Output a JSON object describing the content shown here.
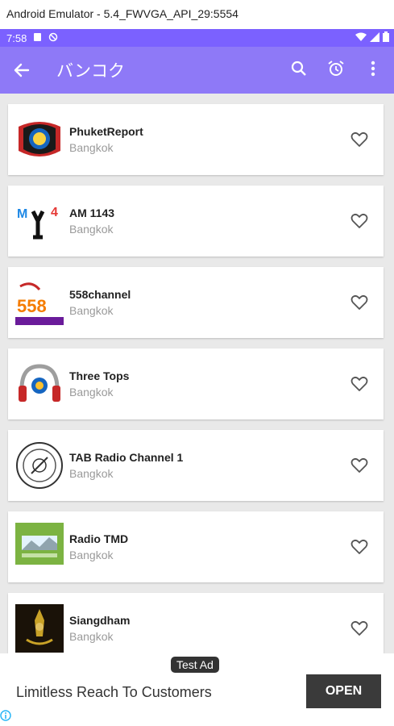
{
  "window": {
    "title": "Android Emulator - 5.4_FWVGA_API_29:5554"
  },
  "status_bar": {
    "time": "7:58"
  },
  "app_bar": {
    "title": "バンコク"
  },
  "colors": {
    "status_bar": "#7b61ff",
    "app_bar": "#8e79f7",
    "list_bg": "#e9e9e9",
    "open_button": "#3a3a3a"
  },
  "stations": [
    {
      "name": "PhuketReport",
      "location": "Bangkok",
      "logo": "police-badge-logo"
    },
    {
      "name": "AM 1143",
      "location": "Bangkok",
      "logo": "am1143-logo"
    },
    {
      "name": "558channel",
      "location": "Bangkok",
      "logo": "558-banner-logo"
    },
    {
      "name": "Three Tops",
      "location": "Bangkok",
      "logo": "headphones-logo"
    },
    {
      "name": "TAB Radio Channel 1",
      "location": "Bangkok",
      "logo": "round-stamp-logo"
    },
    {
      "name": "Radio TMD",
      "location": "Bangkok",
      "logo": "weather-radio-logo"
    },
    {
      "name": "Siangdham",
      "location": "Bangkok",
      "logo": "emblem-logo"
    }
  ],
  "ad": {
    "tag": "Test Ad",
    "headline": "Limitless Reach To Customers",
    "cta": "OPEN"
  }
}
